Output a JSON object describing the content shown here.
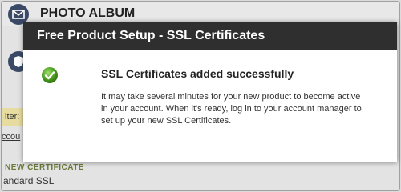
{
  "background": {
    "title": "PHOTO ALBUM",
    "filter_label": "lter:",
    "link_text": "ccou",
    "new_label": "NEW CERTIFICATE",
    "standard_label": "andard SSL"
  },
  "modal": {
    "title": "Free Product Setup - SSL Certificates",
    "status_icon": "check-circle-icon",
    "message_title": "SSL Certificates added successfully",
    "message_body": "It may take several minutes for your new product to become active in your account. When it's ready, log in to your account manager to set up your new SSL Certificates."
  },
  "colors": {
    "modal_header": "#2f2f2f",
    "success_green": "#4a9a1e"
  }
}
